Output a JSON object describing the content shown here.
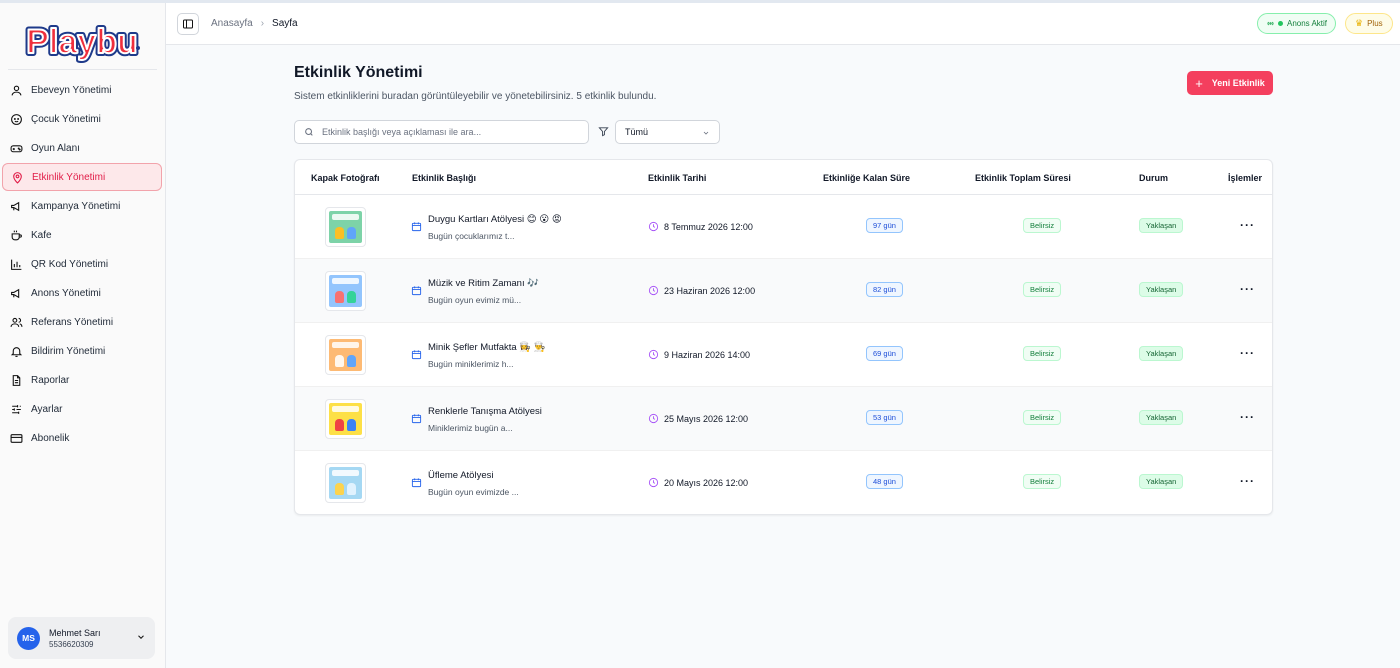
{
  "app": {
    "logo_text": "Playbu"
  },
  "colors": {
    "accent": "#f43f5e",
    "active_bg": "#fde8ea",
    "success": "#15803d",
    "info": "#1d4ed8"
  },
  "sidebar": {
    "items": [
      {
        "label": "Ebeveyn Yönetimi",
        "icon": "user-icon"
      },
      {
        "label": "Çocuk Yönetimi",
        "icon": "baby-face-icon"
      },
      {
        "label": "Oyun Alanı",
        "icon": "gamepad-icon"
      },
      {
        "label": "Etkinlik Yönetimi",
        "icon": "map-pin-icon",
        "active": true
      },
      {
        "label": "Kampanya Yönetimi",
        "icon": "megaphone-icon"
      },
      {
        "label": "Kafe",
        "icon": "coffee-icon"
      },
      {
        "label": "QR Kod Yönetimi",
        "icon": "bar-chart-icon"
      },
      {
        "label": "Anons Yönetimi",
        "icon": "megaphone-icon"
      },
      {
        "label": "Referans Yönetimi",
        "icon": "users-icon"
      },
      {
        "label": "Bildirim Yönetimi",
        "icon": "bell-icon"
      },
      {
        "label": "Raporlar",
        "icon": "file-text-icon"
      },
      {
        "label": "Ayarlar",
        "icon": "sliders-icon"
      },
      {
        "label": "Abonelik",
        "icon": "credit-card-icon"
      }
    ],
    "user": {
      "initials": "MS",
      "name": "Mehmet Sarı",
      "phone": "5536620309"
    }
  },
  "header": {
    "breadcrumb_home": "Anasayfa",
    "breadcrumb_current": "Sayfa",
    "anons_badge": "Anons Aktif",
    "plus_badge": "Plus"
  },
  "main": {
    "title": "Etkinlik Yönetimi",
    "subtitle": "Sistem etkinliklerini buradan görüntüleyebilir ve yönetebilirsiniz. 5 etkinlik bulundu.",
    "new_button": "Yeni Etkinlik",
    "search_placeholder": "Etkinlik başlığı veya açıklaması ile ara...",
    "filter_value": "Tümü"
  },
  "table": {
    "headers": {
      "cover": "Kapak Fotoğrafı",
      "title": "Etkinlik Başlığı",
      "date": "Etkinlik Tarihi",
      "remaining": "Etkinliğe Kalan Süre",
      "total": "Etkinlik Toplam Süresi",
      "status": "Durum",
      "actions": "İşlemler"
    },
    "rows": [
      {
        "title": "Duygu Kartları Atölyesi 😊 😮 😡",
        "desc": "Bugün çocuklarımız t...",
        "date": "8 Temmuz 2026 12:00",
        "remaining": "97 gün",
        "total": "Belirsiz",
        "status": "Yaklaşan",
        "actions": "···",
        "thumb_color": "#7dd3a8"
      },
      {
        "title": "Müzik ve Ritim Zamanı 🎶",
        "desc": "Bugün oyun evimiz mü...",
        "date": "23 Haziran 2026 12:00",
        "remaining": "82 gün",
        "total": "Belirsiz",
        "status": "Yaklaşan",
        "actions": "···",
        "thumb_color": "#93c5fd"
      },
      {
        "title": "Minik Şefler Mutfakta 👩‍🍳 👨‍🍳",
        "desc": "Bugün miniklerimiz h...",
        "date": "9 Haziran 2026 14:00",
        "remaining": "69 gün",
        "total": "Belirsiz",
        "status": "Yaklaşan",
        "actions": "···",
        "thumb_color": "#fdba74"
      },
      {
        "title": "Renklerle Tanışma Atölyesi",
        "desc": "Miniklerimiz bugün a...",
        "date": "25 Mayıs 2026 12:00",
        "remaining": "53 gün",
        "total": "Belirsiz",
        "status": "Yaklaşan",
        "actions": "···",
        "thumb_color": "#fde047"
      },
      {
        "title": "Üfleme Atölyesi",
        "desc": "Bugün oyun evimizde ...",
        "date": "20 Mayıs 2026 12:00",
        "remaining": "48 gün",
        "total": "Belirsiz",
        "status": "Yaklaşan",
        "actions": "···",
        "thumb_color": "#a5d8f3"
      }
    ]
  }
}
